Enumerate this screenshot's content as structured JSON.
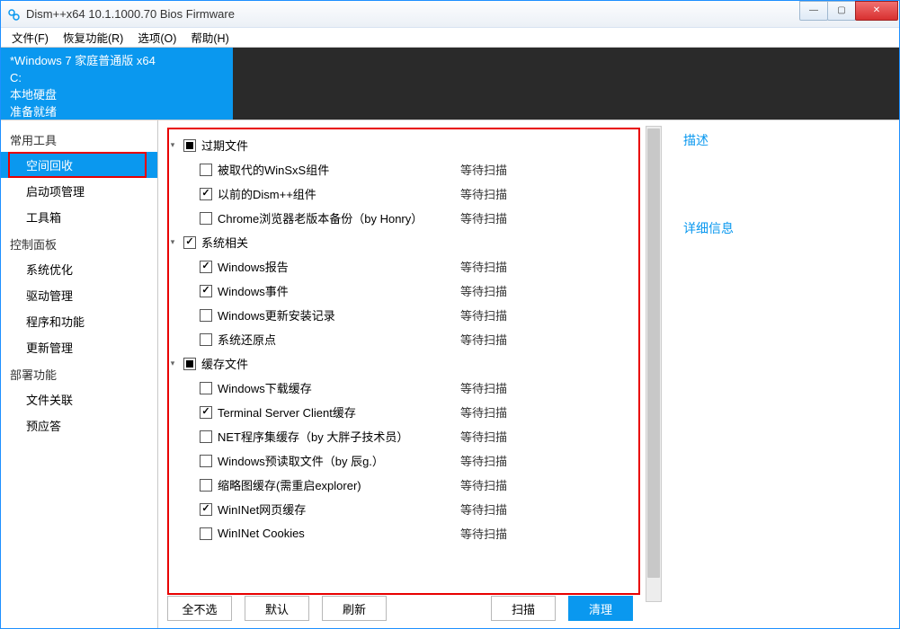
{
  "window": {
    "title": "Dism++x64 10.1.1000.70 Bios Firmware"
  },
  "menubar": [
    "文件(F)",
    "恢复功能(R)",
    "选项(O)",
    "帮助(H)"
  ],
  "infoband": {
    "line1": "*Windows 7 家庭普通版 x64",
    "line2": "C:",
    "line3": "本地硬盘",
    "line4": "准备就绪"
  },
  "sidebar": {
    "groups": [
      {
        "title": "常用工具",
        "items": [
          {
            "label": "空间回收",
            "active": true
          },
          {
            "label": "启动项管理",
            "active": false
          },
          {
            "label": "工具箱",
            "active": false
          }
        ]
      },
      {
        "title": "控制面板",
        "items": [
          {
            "label": "系统优化",
            "active": false
          },
          {
            "label": "驱动管理",
            "active": false
          },
          {
            "label": "程序和功能",
            "active": false
          },
          {
            "label": "更新管理",
            "active": false
          }
        ]
      },
      {
        "title": "部署功能",
        "items": [
          {
            "label": "文件关联",
            "active": false
          },
          {
            "label": "预应答",
            "active": false
          }
        ]
      }
    ]
  },
  "cleanup": {
    "status_text": "等待扫描",
    "groups": [
      {
        "name": "过期文件",
        "state": "tri",
        "expanded": true,
        "items": [
          {
            "label": "被取代的WinSxS组件",
            "checked": false
          },
          {
            "label": "以前的Dism++组件",
            "checked": true
          },
          {
            "label": "Chrome浏览器老版本备份（by Honry）",
            "checked": false
          }
        ]
      },
      {
        "name": "系统相关",
        "state": "checked",
        "expanded": true,
        "items": [
          {
            "label": "Windows报告",
            "checked": true
          },
          {
            "label": "Windows事件",
            "checked": true
          },
          {
            "label": "Windows更新安装记录",
            "checked": false
          },
          {
            "label": "系统还原点",
            "checked": false
          }
        ]
      },
      {
        "name": "缓存文件",
        "state": "tri",
        "expanded": true,
        "items": [
          {
            "label": "Windows下载缓存",
            "checked": false
          },
          {
            "label": "Terminal Server Client缓存",
            "checked": true
          },
          {
            "label": "NET程序集缓存（by 大胖子技术员）",
            "checked": false
          },
          {
            "label": "Windows预读取文件（by 辰g.）",
            "checked": false
          },
          {
            "label": "缩略图缓存(需重启explorer)",
            "checked": false
          },
          {
            "label": "WinINet网页缓存",
            "checked": true
          },
          {
            "label": "WinINet Cookies",
            "checked": false
          }
        ]
      }
    ]
  },
  "right_panel": {
    "desc_title": "描述",
    "detail_title": "详细信息"
  },
  "buttons": {
    "none": "全不选",
    "default": "默认",
    "refresh": "刷新",
    "scan": "扫描",
    "clean": "清理"
  }
}
